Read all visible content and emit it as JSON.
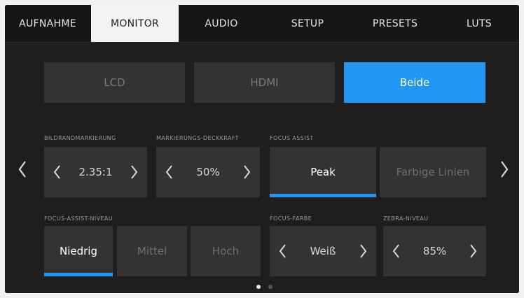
{
  "tabs": [
    {
      "label": "AUFNAHME",
      "active": false
    },
    {
      "label": "MONITOR",
      "active": true
    },
    {
      "label": "AUDIO",
      "active": false
    },
    {
      "label": "SETUP",
      "active": false
    },
    {
      "label": "PRESETS",
      "active": false
    },
    {
      "label": "LUTS",
      "active": false
    }
  ],
  "output": {
    "options": [
      "LCD",
      "HDMI",
      "Beide"
    ],
    "selected": "Beide"
  },
  "frame_guides": {
    "label": "BILDRANDMARKIERUNG",
    "value": "2.35:1"
  },
  "guide_opacity": {
    "label": "MARKIERUNGS-DECKKRAFT",
    "value": "50%"
  },
  "focus_assist": {
    "label": "FOCUS ASSIST",
    "options": [
      "Peak",
      "Farbige Linien"
    ],
    "selected": "Peak"
  },
  "focus_assist_level": {
    "label": "FOCUS-ASSIST-NIVEAU",
    "options": [
      "Niedrig",
      "Mittel",
      "Hoch"
    ],
    "selected": "Niedrig"
  },
  "focus_color": {
    "label": "FOCUS-FARBE",
    "value": "Weiß"
  },
  "zebra_level": {
    "label": "ZEBRA-NIVEAU",
    "value": "85%"
  },
  "pagination": {
    "pages": 2,
    "current": 1
  },
  "colors": {
    "accent": "#2196f3",
    "panel": "#333333",
    "background": "#1e1e1e"
  },
  "icons": {
    "prev_page": "chevron-left-icon",
    "next_page": "chevron-right-icon"
  }
}
